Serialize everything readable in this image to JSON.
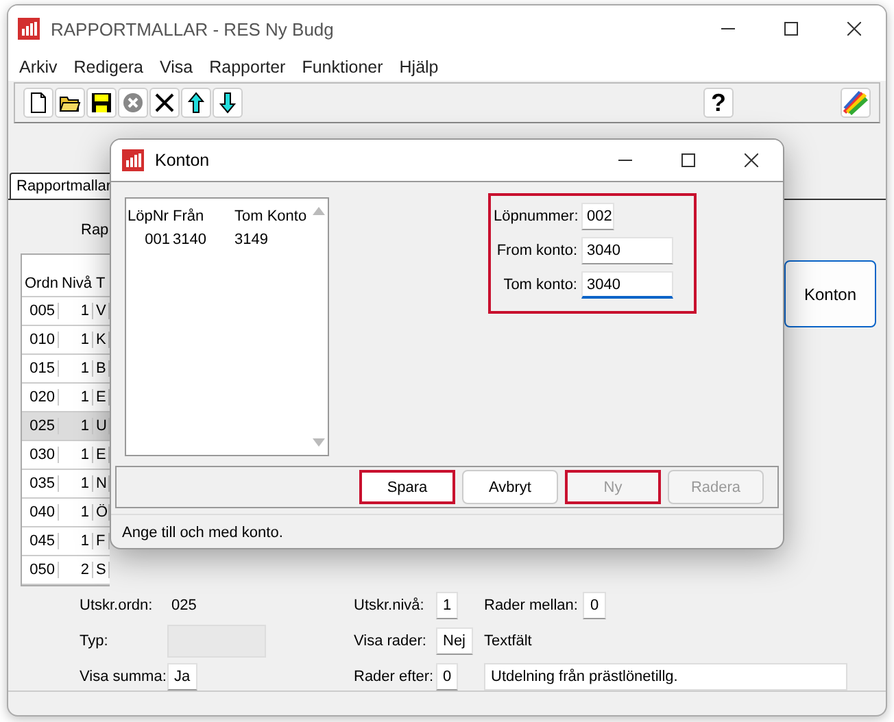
{
  "window": {
    "title": "RAPPORTMALLAR - RES Ny Budg"
  },
  "menu": [
    "Arkiv",
    "Redigera",
    "Visa",
    "Rapporter",
    "Funktioner",
    "Hjälp"
  ],
  "toolbar": {
    "help": "?"
  },
  "tabs": [
    {
      "label": "Rapportmallar",
      "selected": true
    }
  ],
  "panel": {
    "label": "Rap",
    "grid": {
      "columns": [
        "Ordn",
        "Nivå",
        "T"
      ],
      "rows": [
        {
          "cells": [
            "005",
            "1",
            "V"
          ],
          "selected": false
        },
        {
          "cells": [
            "010",
            "1",
            "K"
          ],
          "selected": false
        },
        {
          "cells": [
            "015",
            "1",
            "B"
          ],
          "selected": false
        },
        {
          "cells": [
            "020",
            "1",
            "E"
          ],
          "selected": false
        },
        {
          "cells": [
            "025",
            "1",
            "U"
          ],
          "selected": true
        },
        {
          "cells": [
            "030",
            "1",
            "E"
          ],
          "selected": false
        },
        {
          "cells": [
            "035",
            "1",
            "N"
          ],
          "selected": false
        },
        {
          "cells": [
            "040",
            "1",
            "Ö"
          ],
          "selected": false
        },
        {
          "cells": [
            "045",
            "1",
            "F"
          ],
          "selected": false
        },
        {
          "cells": [
            "050",
            "2",
            "S"
          ],
          "selected": false
        }
      ]
    },
    "side_button": "Konton",
    "form": [
      {
        "items": [
          {
            "kind": "label",
            "text": "Utskr.ordn:"
          },
          {
            "kind": "value",
            "text": "025"
          },
          {
            "kind": "label",
            "text": "Utskr.nivå:"
          },
          {
            "kind": "field",
            "text": "1"
          },
          {
            "kind": "label",
            "text": "Rader mellan:"
          },
          {
            "kind": "field",
            "text": "0"
          }
        ]
      },
      {
        "items": [
          {
            "kind": "label",
            "text": "Typ:"
          },
          {
            "kind": "empty"
          },
          {
            "kind": "label",
            "text": "Visa rader:"
          },
          {
            "kind": "field",
            "text": "Nej"
          },
          {
            "kind": "label",
            "text": "Textfält"
          }
        ]
      },
      {
        "items": [
          {
            "kind": "label",
            "text": "Visa summa:"
          },
          {
            "kind": "field",
            "text": "Ja"
          },
          {
            "kind": "label",
            "text": "Rader efter:"
          },
          {
            "kind": "field",
            "text": "0"
          },
          {
            "kind": "wide",
            "text": "Utdelning från prästlönetillg."
          }
        ]
      }
    ]
  },
  "dialog": {
    "title": "Konton",
    "list": {
      "columns": [
        "LöpNr",
        "Från",
        "Tom Konto"
      ],
      "rows": [
        [
          "001",
          "3140",
          "3149"
        ]
      ]
    },
    "group": {
      "highlighted": true,
      "fields": [
        {
          "label": "Löpnummer:",
          "value": "002",
          "kind": "short",
          "focused": false
        },
        {
          "label": "From konto:",
          "value": "3040",
          "kind": "long",
          "focused": false
        },
        {
          "label": "Tom konto:",
          "value": "3040",
          "kind": "long",
          "focused": true
        }
      ]
    },
    "buttons": [
      {
        "label": "Spara",
        "disabled": false,
        "highlighted": true
      },
      {
        "label": "Avbryt",
        "disabled": false,
        "highlighted": false
      },
      {
        "label": "Ny",
        "disabled": true,
        "highlighted": true
      },
      {
        "label": "Radera",
        "disabled": true,
        "highlighted": false
      }
    ],
    "status": "Ange till och med konto."
  }
}
